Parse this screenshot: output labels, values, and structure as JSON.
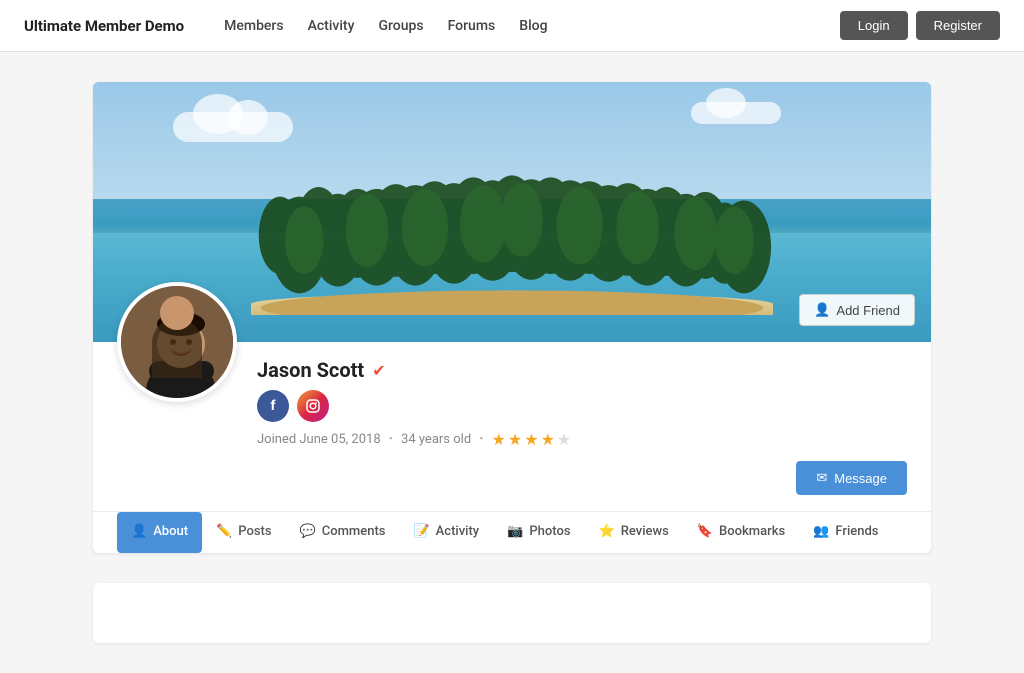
{
  "header": {
    "logo": "Ultimate Member Demo",
    "nav": [
      {
        "label": "Members",
        "href": "#"
      },
      {
        "label": "Activity",
        "href": "#"
      },
      {
        "label": "Groups",
        "href": "#"
      },
      {
        "label": "Forums",
        "href": "#"
      },
      {
        "label": "Blog",
        "href": "#"
      }
    ],
    "login_label": "Login",
    "register_label": "Register"
  },
  "profile": {
    "name": "Jason Scott",
    "verified": true,
    "joined": "Joined June 05, 2018",
    "age": "34 years old",
    "stars": 3.5,
    "add_friend_label": "Add Friend",
    "message_label": "Message",
    "social": [
      {
        "name": "Facebook",
        "short": "f"
      },
      {
        "name": "Instagram",
        "short": "in"
      }
    ],
    "tabs": [
      {
        "label": "About",
        "icon": "👤",
        "active": true
      },
      {
        "label": "Posts",
        "icon": "✏️",
        "active": false
      },
      {
        "label": "Comments",
        "icon": "💬",
        "active": false
      },
      {
        "label": "Activity",
        "icon": "📝",
        "active": false
      },
      {
        "label": "Photos",
        "icon": "📷",
        "active": false
      },
      {
        "label": "Reviews",
        "icon": "⭐",
        "active": false
      },
      {
        "label": "Bookmarks",
        "icon": "🔖",
        "active": false
      },
      {
        "label": "Friends",
        "icon": "👥",
        "active": false
      }
    ]
  }
}
